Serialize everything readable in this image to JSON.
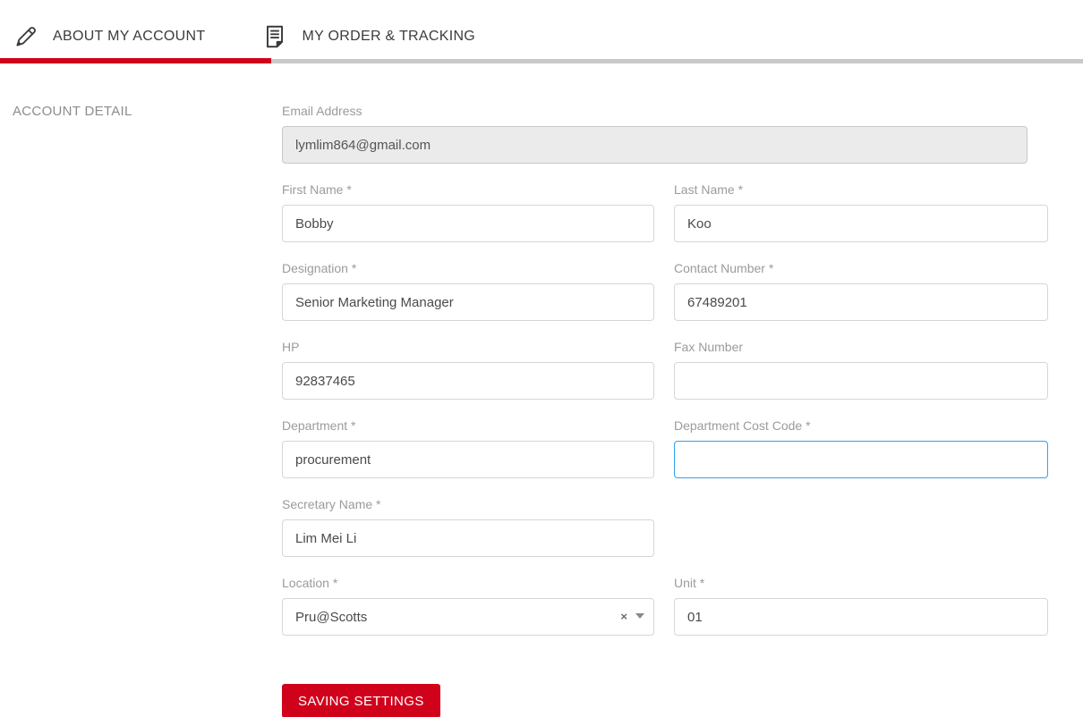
{
  "tabs": [
    {
      "label": "ABOUT MY ACCOUNT",
      "icon": "pencil-icon",
      "active": true
    },
    {
      "label": "MY ORDER & TRACKING",
      "icon": "document-icon",
      "active": false
    }
  ],
  "sidebar": {
    "section_label": "ACCOUNT DETAIL"
  },
  "form": {
    "email": {
      "label": "Email Address",
      "value": "lymlim864@gmail.com",
      "state": "disabled"
    },
    "first_name": {
      "label": "First Name *",
      "value": "Bobby"
    },
    "last_name": {
      "label": "Last Name *",
      "value": "Koo"
    },
    "designation": {
      "label": "Designation *",
      "value": "Senior Marketing Manager"
    },
    "contact_number": {
      "label": "Contact Number *",
      "value": "67489201"
    },
    "hp": {
      "label": "HP",
      "value": "92837465"
    },
    "fax_number": {
      "label": "Fax Number",
      "value": ""
    },
    "department": {
      "label": "Department *",
      "value": "procurement"
    },
    "department_cost_code": {
      "label": "Department Cost Code *",
      "value": "",
      "state": "focused"
    },
    "secretary_name": {
      "label": "Secretary Name *",
      "value": "Lim Mei Li"
    },
    "location": {
      "label": "Location *",
      "value": "Pru@Scotts",
      "clear_glyph": "×"
    },
    "unit": {
      "label": "Unit *",
      "value": "01"
    },
    "save_button_label": "SAVING SETTINGS"
  },
  "colors": {
    "brand-red": "#d0021b",
    "bar-gray": "#c9c9c9",
    "label-gray": "#9b9b9b",
    "sidebar-gray": "#8c8c8c",
    "input-border": "#d6d6d6",
    "input-text": "#4a4a4a",
    "disabled-bg": "#ebebeb",
    "focus-blue": "#35a0ef",
    "tab-text": "#3c3c3c"
  }
}
